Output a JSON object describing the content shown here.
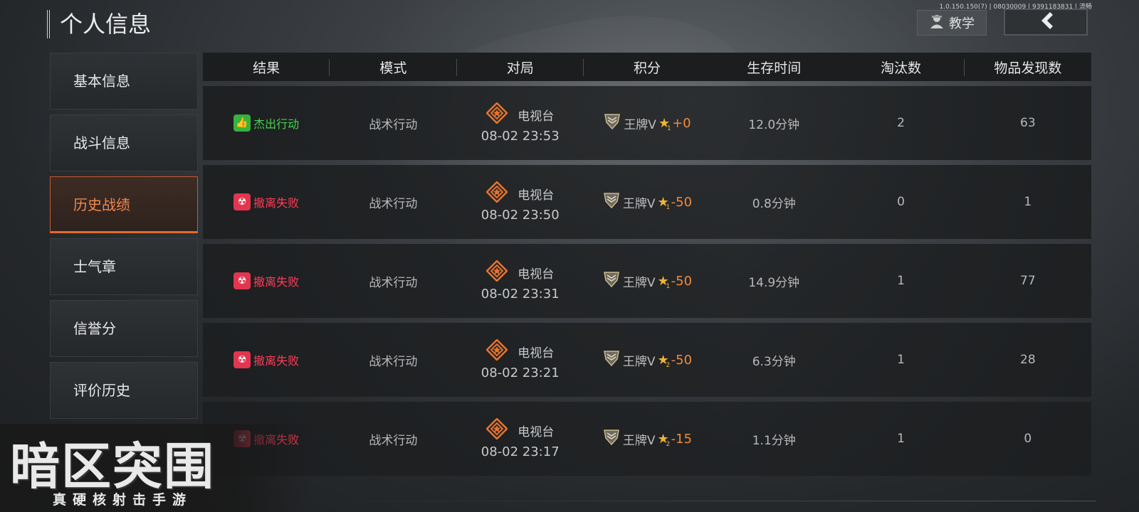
{
  "build_info": "1.0.150.150(7) | 08030009 | 9391183831 | 流畅",
  "page_title": "个人信息",
  "header": {
    "tutorial_label": "教学"
  },
  "sidebar": {
    "items": [
      {
        "label": "基本信息"
      },
      {
        "label": "战斗信息"
      },
      {
        "label": "历史战绩"
      },
      {
        "label": "士气章"
      },
      {
        "label": "信誉分"
      },
      {
        "label": "评价历史"
      }
    ]
  },
  "table": {
    "columns": [
      "结果",
      "模式",
      "对局",
      "积分",
      "生存时间",
      "淘汰数",
      "物品发现数"
    ],
    "rows": [
      {
        "result": "杰出行动",
        "result_type": "good",
        "mode": "战术行动",
        "map": "电视台",
        "time": "08-02 23:53",
        "rank": "王牌V",
        "star_level": "1",
        "delta": "+0",
        "survival": "12.0分钟",
        "kills": "2",
        "items": "63"
      },
      {
        "result": "撤离失败",
        "result_type": "fail",
        "mode": "战术行动",
        "map": "电视台",
        "time": "08-02 23:50",
        "rank": "王牌V",
        "star_level": "1",
        "delta": "-50",
        "survival": "0.8分钟",
        "kills": "0",
        "items": "1"
      },
      {
        "result": "撤离失败",
        "result_type": "fail",
        "mode": "战术行动",
        "map": "电视台",
        "time": "08-02 23:31",
        "rank": "王牌V",
        "star_level": "1",
        "delta": "-50",
        "survival": "14.9分钟",
        "kills": "1",
        "items": "77"
      },
      {
        "result": "撤离失败",
        "result_type": "fail",
        "mode": "战术行动",
        "map": "电视台",
        "time": "08-02 23:21",
        "rank": "王牌V",
        "star_level": "2",
        "delta": "-50",
        "survival": "6.3分钟",
        "kills": "1",
        "items": "28"
      },
      {
        "result": "撤离失败",
        "result_type": "fail",
        "mode": "战术行动",
        "map": "电视台",
        "time": "08-02 23:17",
        "rank": "王牌V",
        "star_level": "2",
        "delta": "-15",
        "survival": "1.1分钟",
        "kills": "1",
        "items": "0"
      }
    ]
  },
  "logo": {
    "title": "暗区突围",
    "subtitle": "真硬核射击手游"
  },
  "colors": {
    "accent": "#e2692f",
    "good": "#46d34e",
    "fail": "#ff3d57",
    "delta": "#f08a3c"
  },
  "icons": {
    "tutorial": "soldier-icon",
    "back": "chevron-left-icon",
    "good_result": "thumbs-up-icon",
    "fail_result": "skull-icon",
    "map": "diamond-star-icon",
    "rank": "rank-badge-icon",
    "star": "star-icon"
  }
}
